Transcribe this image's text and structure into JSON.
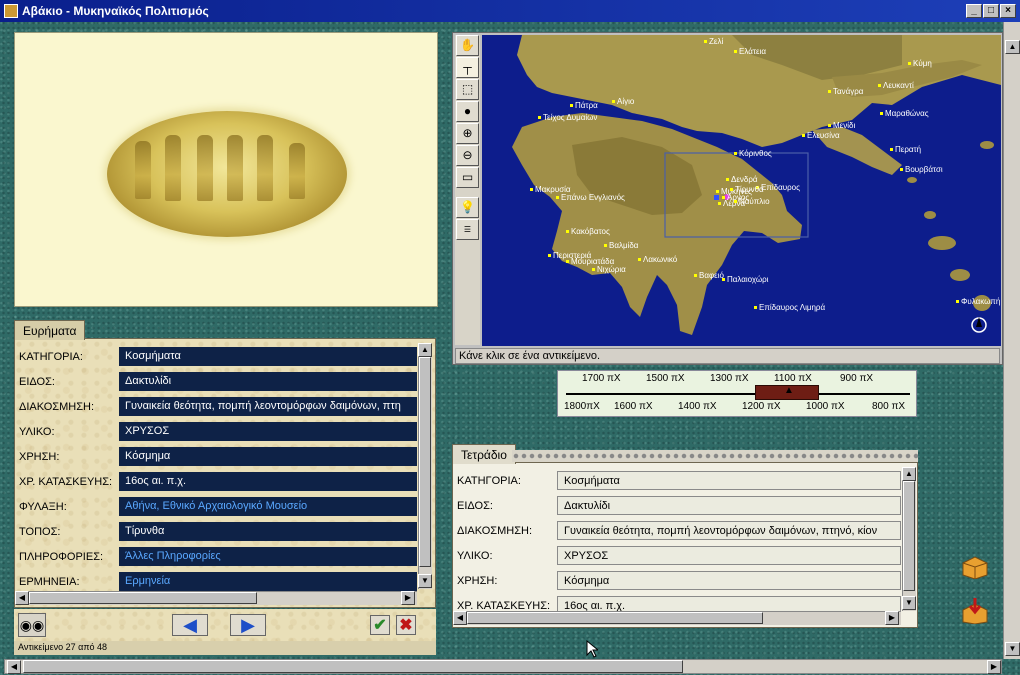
{
  "window": {
    "title": "Αβάκιο - Μυκηναϊκός Πολιτισμός",
    "buttons": {
      "minimize": "_",
      "maximize": "□",
      "close": "×"
    }
  },
  "findings_panel": {
    "tab_label": "Ευρήματα",
    "rows": [
      {
        "label": "ΚΑΤΗΓΟΡΙΑ:",
        "value": "Κοσμήματα",
        "link": false
      },
      {
        "label": "ΕΙΔΟΣ:",
        "value": "Δακτυλίδι",
        "link": false
      },
      {
        "label": "ΔΙΑΚΟΣΜΗΣΗ:",
        "value": "Γυναικεία θεότητα, πομπή λεοντομόρφων δαιμόνων, πτη",
        "link": false
      },
      {
        "label": "ΥΛΙΚΟ:",
        "value": "ΧΡΥΣΟΣ",
        "link": false
      },
      {
        "label": "ΧΡΗΣΗ:",
        "value": "Κόσμημα",
        "link": false
      },
      {
        "label": "ΧΡ. ΚΑΤΑΣΚΕΥΗΣ:",
        "value": "16ος αι. π.χ.",
        "link": false
      },
      {
        "label": "ΦΥΛΑΞΗ:",
        "value": "Αθήνα, Εθνικό Αρχαιολογικό Μουσείο",
        "link": true
      },
      {
        "label": "ΤΟΠΟΣ:",
        "value": "Τίρυνθα",
        "link": false
      },
      {
        "label": "ΠΛΗΡΟΦΟΡΙΕΣ:",
        "value": "Άλλες Πληροφορίες",
        "link": true
      },
      {
        "label": "ΕΡΜΗΝΕΙΑ:",
        "value": "Ερμηνεία",
        "link": true
      }
    ]
  },
  "notebook_panel": {
    "tab_label": "Τετράδιο",
    "rows": [
      {
        "label": "ΚΑΤΗΓΟΡΙΑ:",
        "value": "Κοσμήματα"
      },
      {
        "label": "ΕΙΔΟΣ:",
        "value": "Δακτυλίδι"
      },
      {
        "label": "ΔΙΑΚΟΣΜΗΣΗ:",
        "value": "Γυναικεία θεότητα, πομπή λεοντομόρφων δαιμόνων, πτηνό, κίον"
      },
      {
        "label": "ΥΛΙΚΟ:",
        "value": "ΧΡΥΣΟΣ"
      },
      {
        "label": "ΧΡΗΣΗ:",
        "value": "Κόσμημα"
      },
      {
        "label": "ΧΡ. ΚΑΤΑΣΚΕΥΗΣ:",
        "value": "16ος αι. π.χ."
      }
    ]
  },
  "map": {
    "status": "Κάνε κλικ σε ένα αντικείμενο.",
    "tools": [
      "hand-icon",
      "pointer-icon",
      "select-rect-icon",
      "point-icon",
      "zoom-in-icon",
      "zoom-out-icon",
      "ruler-icon",
      "lightbulb-icon",
      "legend-icon"
    ],
    "places": [
      "Ζελί",
      "Ελάτεια",
      "Κύμη",
      "Τανάγρα",
      "Λευκαντί",
      "Πάτρα",
      "Αίγιο",
      "Τείχος Δυμαίων",
      "Μενίδι",
      "Μαραθώνας",
      "Ελευσίνα",
      "Περατή",
      "Κόρινθος",
      "Βουρβάτσι",
      "Δενδρά",
      "Επίδαυρος",
      "Μυκήνες",
      "Άργος",
      "Λέρνα",
      "Ναύπλιο",
      "Τίρυνθα",
      "Μακρυσία",
      "Επάνω Ενγλιανός",
      "Κακόβατος",
      "Βαλμίδα",
      "Περιστεριά",
      "Μουριατάδα",
      "Νιχώρια",
      "Λακωνικό",
      "Βαφειό",
      "Παλαιοχώρι",
      "Επίδαυρος Λιμηρά",
      "Φυλακωπή"
    ]
  },
  "timeline": {
    "top_labels": [
      "1700 πΧ",
      "1500 πΧ",
      "1300 πΧ",
      "1100 πΧ",
      "900 πΧ"
    ],
    "bottom_labels": [
      "1800πΧ",
      "1600 πΧ",
      "1400 πΧ",
      "1200 πΧ",
      "1000 πΧ",
      "800 πΧ"
    ],
    "selected_range": "1100 πΧ"
  },
  "left_toolbar": {
    "prev": "◀",
    "next": "▶",
    "ok": "✔",
    "cancel": "✖"
  },
  "status": {
    "object_counter": "Αντικείμενο 27 από 48"
  },
  "colors": {
    "title_bar": "#0a1f8c",
    "dark_field": "#0e2247",
    "link_text": "#5aa8ff",
    "sea": "#0d1d8c",
    "timeline_bar": "#6e1d14"
  }
}
